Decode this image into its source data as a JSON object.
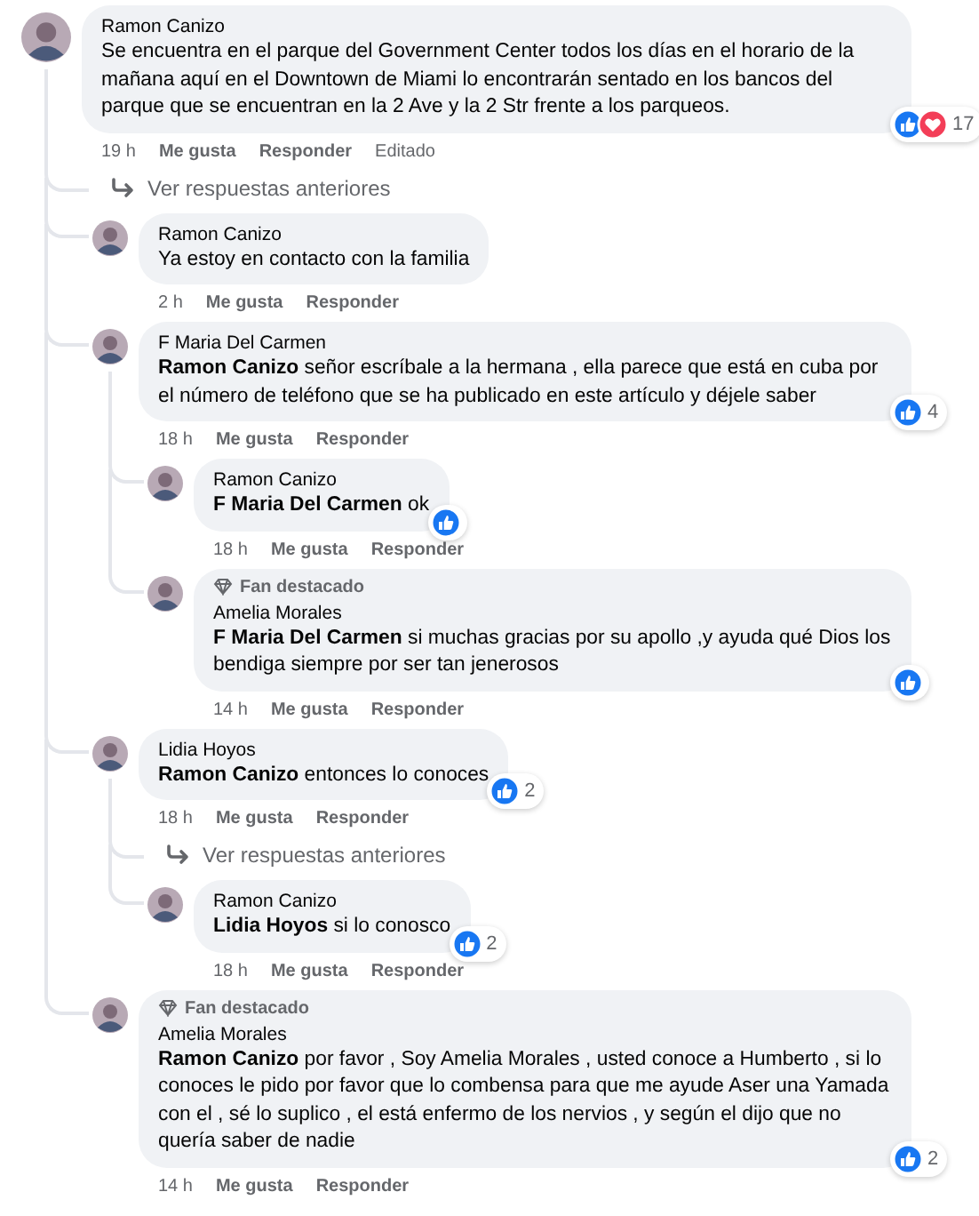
{
  "comments": [
    {
      "kind": "comment",
      "author": "Ramon Canizo",
      "text": "Se encuentra en el parque del Government Center todos los días en el horario de la mañana aquí en el Downtown de Miami lo encontrarán sentado en los bancos del parque que se encuentran en la 2 Ave y la 2 Str frente a los parqueos.",
      "time": "19 h",
      "actions": [
        "Me gusta",
        "Responder"
      ],
      "edited": "Editado",
      "reactions": {
        "icons": [
          {
            "kind": "like"
          },
          {
            "kind": "love"
          }
        ],
        "count": "17"
      },
      "children": [
        {
          "kind": "more_replies",
          "label": "Ver respuestas anteriores"
        },
        {
          "kind": "comment",
          "author": "Ramon Canizo",
          "text": "Ya estoy en contacto con la familia",
          "time": "2 h",
          "actions": [
            "Me gusta",
            "Responder"
          ]
        },
        {
          "kind": "comment",
          "author": "F Maria Del Carmen",
          "text": "**Ramon Canizo** señor escríbale a la hermana , ella parece que está en cuba por el número de teléfono que se ha publicado en este artículo y déjele saber",
          "time": "18 h",
          "actions": [
            "Me gusta",
            "Responder"
          ],
          "reactions": {
            "icons": [
              {
                "kind": "like"
              }
            ],
            "count": "4"
          },
          "children": [
            {
              "kind": "comment",
              "author": "Ramon Canizo",
              "text": "**F Maria Del Carmen** ok",
              "time": "18 h",
              "actions": [
                "Me gusta",
                "Responder"
              ],
              "reactions": {
                "icons": [
                  {
                    "kind": "like"
                  }
                ]
              }
            },
            {
              "kind": "comment",
              "badge": "Fan destacado",
              "author": "Amelia Morales",
              "text": "**F Maria Del Carmen** si muchas gracias por su apollo ,y ayuda qué Dios los bendiga siempre por ser tan jenerosos",
              "time": "14 h",
              "actions": [
                "Me gusta",
                "Responder"
              ],
              "reactions": {
                "icons": [
                  {
                    "kind": "like"
                  }
                ]
              }
            }
          ]
        },
        {
          "kind": "comment",
          "author": "Lidia Hoyos",
          "text": "**Ramon Canizo** entonces lo conoces",
          "time": "18 h",
          "actions": [
            "Me gusta",
            "Responder"
          ],
          "reactions": {
            "icons": [
              {
                "kind": "like"
              }
            ],
            "count": "2"
          },
          "children": [
            {
              "kind": "more_replies",
              "label": "Ver respuestas anteriores"
            },
            {
              "kind": "comment",
              "author": "Ramon Canizo",
              "text": "**Lidia Hoyos** si lo conosco",
              "time": "18 h",
              "actions": [
                "Me gusta",
                "Responder"
              ],
              "reactions": {
                "icons": [
                  {
                    "kind": "like"
                  }
                ],
                "count": "2"
              }
            }
          ]
        },
        {
          "kind": "comment",
          "badge": "Fan destacado",
          "author": "Amelia Morales",
          "text": "**Ramon Canizo** por favor , Soy Amelia Morales , usted conoce a Humberto , si lo conoces le pido por favor que lo combensa para que me ayude Aser una Yamada con el , sé lo suplico , el está enfermo de los nervios , y según el dijo que no quería saber de nadie",
          "time": "14 h",
          "actions": [
            "Me gusta",
            "Responder"
          ],
          "reactions": {
            "icons": [
              {
                "kind": "like"
              }
            ],
            "count": "2"
          }
        }
      ]
    }
  ]
}
